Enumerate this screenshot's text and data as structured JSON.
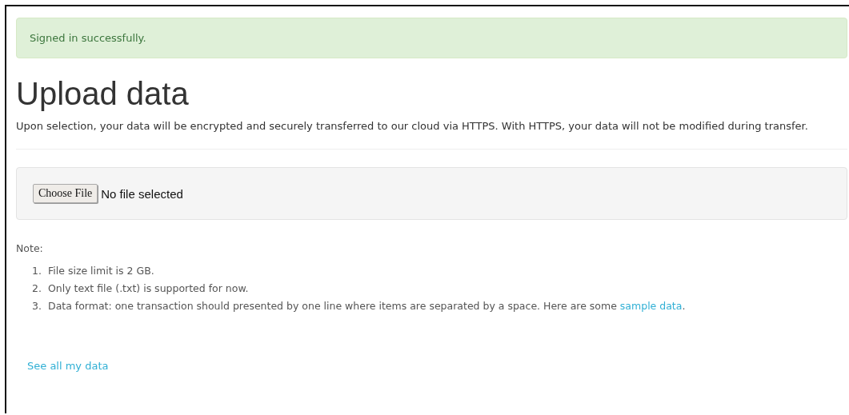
{
  "alert": {
    "text": "Signed in successfully."
  },
  "title": "Upload data",
  "intro": "Upon selection, your data will be encrypted and securely transferred to our cloud via HTTPS. With HTTPS, your data will not be modified during transfer.",
  "upload": {
    "button": "Choose File",
    "status": "No file selected"
  },
  "note": {
    "label": "Note:",
    "items": [
      {
        "number": "1.",
        "text": "File size limit is 2 GB."
      },
      {
        "number": "2.",
        "text": "Only text file (.txt) is supported for now."
      },
      {
        "number": "3.",
        "text": "Data format: one transaction should presented by one line where items are separated by a space. Here are some ",
        "link": "sample data",
        "after": "."
      }
    ]
  },
  "footer_link": "See all my data"
}
